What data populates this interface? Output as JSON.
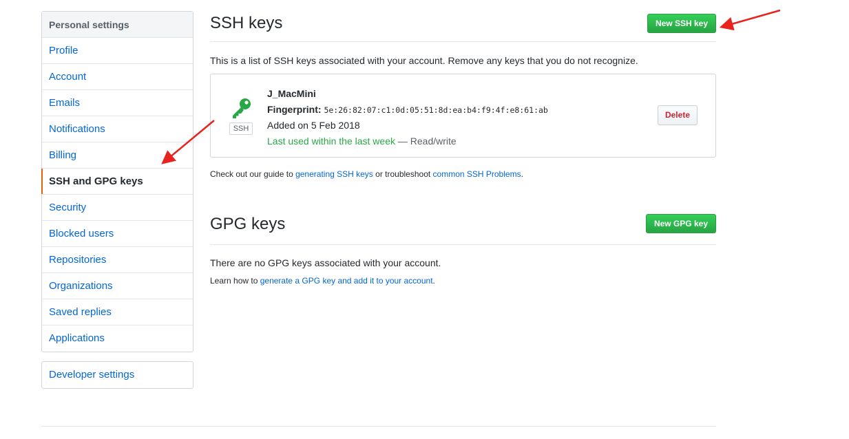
{
  "sidebar": {
    "heading": "Personal settings",
    "items": [
      {
        "label": "Profile"
      },
      {
        "label": "Account"
      },
      {
        "label": "Emails"
      },
      {
        "label": "Notifications"
      },
      {
        "label": "Billing"
      },
      {
        "label": "SSH and GPG keys",
        "selected": true
      },
      {
        "label": "Security"
      },
      {
        "label": "Blocked users"
      },
      {
        "label": "Repositories"
      },
      {
        "label": "Organizations"
      },
      {
        "label": "Saved replies"
      },
      {
        "label": "Applications"
      }
    ],
    "developer_settings": "Developer settings"
  },
  "ssh": {
    "title": "SSH keys",
    "new_button": "New SSH key",
    "description": "This is a list of SSH keys associated with your account. Remove any keys that you do not recognize.",
    "key": {
      "name": "J_MacMini",
      "fingerprint_label": "Fingerprint:",
      "fingerprint": "5e:26:82:07:c1:0d:05:51:8d:ea:b4:f9:4f:e8:61:ab",
      "added": "Added on 5 Feb 2018",
      "last_used": "Last used within the last week",
      "access": " — Read/write",
      "type_label": "SSH",
      "icon": "key-icon",
      "delete_button": "Delete"
    },
    "guide_prefix": "Check out our guide to ",
    "guide_link1": "generating SSH keys",
    "guide_middle": " or troubleshoot ",
    "guide_link2": "common SSH Problems",
    "guide_suffix": "."
  },
  "gpg": {
    "title": "GPG keys",
    "new_button": "New GPG key",
    "empty": "There are no GPG keys associated with your account.",
    "learn_prefix": "Learn how to ",
    "learn_link": "generate a GPG key and add it to your account",
    "learn_suffix": "."
  },
  "colors": {
    "link": "#0366d6",
    "green": "#28a745",
    "danger": "#cb2431",
    "selected_marker": "#e36209",
    "annotation_arrow": "#e8231d"
  }
}
